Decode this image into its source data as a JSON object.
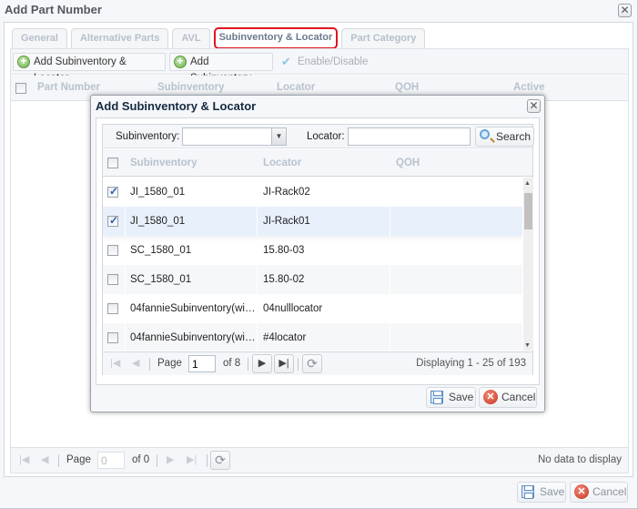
{
  "outer_window": {
    "title": "Add Part Number",
    "tabs": [
      {
        "label": "General",
        "active": false
      },
      {
        "label": "Alternative Parts",
        "active": false
      },
      {
        "label": "AVL",
        "active": false
      },
      {
        "label": "Subinventory & Locator",
        "active": true
      },
      {
        "label": "Part Category",
        "active": false
      }
    ],
    "toolbar": {
      "add_sub_loc": "Add Subinventory & Locator",
      "add_sub": "Add Subinventory",
      "enable_disable": "Enable/Disable"
    },
    "grid": {
      "columns": [
        "Part Number",
        "Subinventory",
        "Locator",
        "QOH",
        "Active"
      ]
    },
    "pager": {
      "page_label": "Page",
      "page_value": "0",
      "of_label": "of 0",
      "status": "No data to display"
    },
    "footer": {
      "save": "Save",
      "cancel": "Cancel"
    }
  },
  "modal": {
    "title": "Add Subinventory & Locator",
    "filters": {
      "subinventory_label": "Subinventory:",
      "subinventory_value": "",
      "locator_label": "Locator:",
      "locator_value": "",
      "search": "Search"
    },
    "columns": [
      "Subinventory",
      "Locator",
      "QOH"
    ],
    "rows": [
      {
        "subinventory": "JI_1580_01",
        "locator": "JI-Rack02",
        "qoh": "",
        "checked": true
      },
      {
        "subinventory": "JI_1580_01",
        "locator": "JI-Rack01",
        "qoh": "",
        "checked": true
      },
      {
        "subinventory": "SC_1580_01",
        "locator": "15.80-03",
        "qoh": "",
        "checked": false
      },
      {
        "subinventory": "SC_1580_01",
        "locator": "15.80-02",
        "qoh": "",
        "checked": false
      },
      {
        "subinventory": "04fannieSubinventory(wi…",
        "locator": "04nulllocator",
        "qoh": "",
        "checked": false
      },
      {
        "subinventory": "04fannieSubinventory(wi…",
        "locator": "#4locator",
        "qoh": "",
        "checked": false
      }
    ],
    "pager": {
      "page_label": "Page",
      "page_value": "1",
      "of_label": "of 8",
      "status": "Displaying 1 - 25 of 193"
    },
    "footer": {
      "save": "Save",
      "cancel": "Cancel"
    }
  }
}
